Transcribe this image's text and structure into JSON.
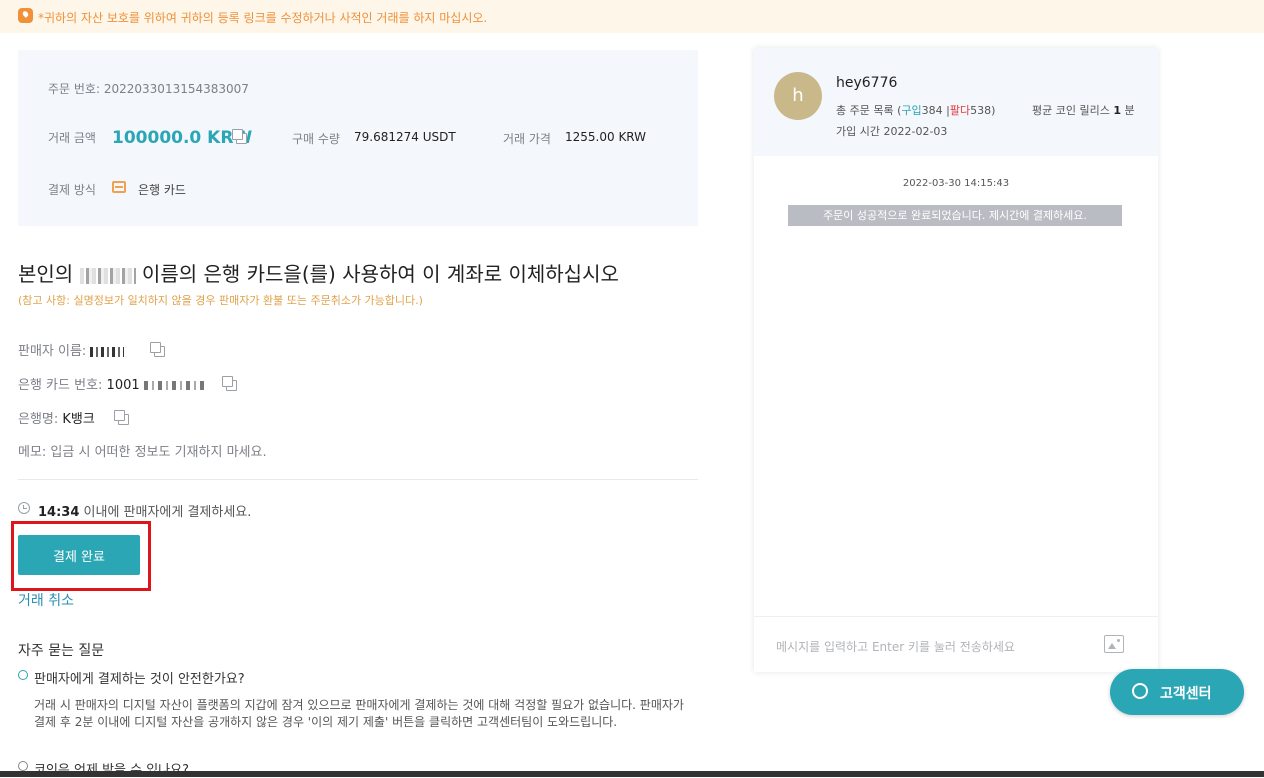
{
  "banner": {
    "text": "*귀하의 자산 보호를 위하여 귀하의 등록 링크를 수정하거나 사적인 거래를 하지 마십시오."
  },
  "order": {
    "number_label": "주문 번호:",
    "number": "2022033013154383007",
    "amount_label": "거래 금액",
    "amount": "100000.0 KRW",
    "quantity_label": "구매 수량",
    "quantity": "79.681274 USDT",
    "price_label": "거래 가격",
    "price": "1255.00 KRW",
    "method_label": "결제 방식",
    "method": "은행 카드"
  },
  "instruction": {
    "headline_prefix": "본인의",
    "headline_suffix": "이름의 은행 카드을(를) 사용하여 이 계좌로 이체하십시오",
    "note": "(참고 사항: 실명정보가 일치하지 않을 경우 판매자가 환불 또는 주문취소가 가능합니다.)"
  },
  "payee": {
    "seller_label": "판매자 이름:",
    "card_label": "은행 카드 번호:",
    "card_prefix": "1001",
    "bank_label": "은행명:",
    "bank_name": "K뱅크",
    "memo": "메모: 입금 시 어떠한 정보도 기재하지 마세요."
  },
  "timer": {
    "time": "14:34",
    "text": " 이내에 판매자에게 결제하세요."
  },
  "actions": {
    "pay_label": "결제 완료",
    "cancel_label": "거래 취소"
  },
  "faq": {
    "title": "자주 묻는 질문",
    "q1": "판매자에게 결제하는 것이 안전한가요?",
    "a1": "거래 시 판매자의 디지털 자산이 플랫폼의 지갑에 잠겨 있으므로 판매자에게 결제하는 것에 대해 걱정할 필요가 없습니다. 판매자가 결제 후 2분 이내에 디지털 자산을 공개하지 않은 경우 '이의 제기 제출' 버튼을 클릭하면 고객센터팀이 도와드립니다.",
    "q2": "코인은 언제 받을 수 있나요?"
  },
  "chat": {
    "avatar_letter": "h",
    "username": "hey6776",
    "orders_label": "총 주문 목록 (",
    "buy_label": "구입",
    "buy_count": "384",
    "sep": " |",
    "sell_label": "팔다",
    "sell_count": "538",
    "close_paren": ")",
    "release_label": "평균 코인 릴리스",
    "release_value": "1",
    "release_unit": "분",
    "joined_label": "가입 시간",
    "joined_date": "2022-02-03",
    "message_time": "2022-03-30 14:15:43",
    "system_message": "주문이 성공적으로 완료되었습니다. 제시간에 결제하세요.",
    "input_placeholder": "메시지를 입력하고 Enter 키를 눌러 전송하세요"
  },
  "support": {
    "label": "고객센터"
  },
  "colors": {
    "accent": "#2aa6b5",
    "warning": "#f0913a",
    "highlight": "#e0151c"
  }
}
